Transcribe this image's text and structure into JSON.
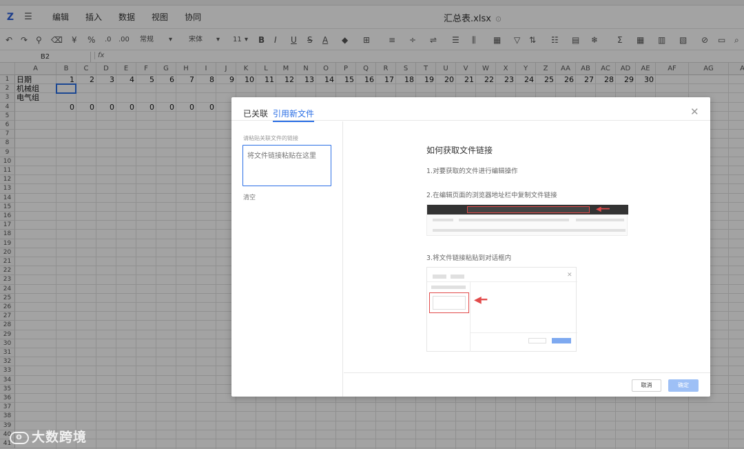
{
  "menu": {
    "logo": "Z",
    "items": [
      "编辑",
      "插入",
      "数据",
      "视图",
      "协同"
    ],
    "doc_title": "汇总表.xlsx"
  },
  "toolbar": {
    "number_format": "常规",
    "font_name": "宋体",
    "font_size": "11"
  },
  "formula": {
    "cell_ref": "B2",
    "fx": "fx"
  },
  "grid": {
    "columns": [
      "A",
      "B",
      "C",
      "D",
      "E",
      "F",
      "G",
      "H",
      "I",
      "J",
      "K",
      "L",
      "M",
      "N",
      "O",
      "P",
      "Q",
      "R",
      "S",
      "T",
      "U",
      "V",
      "W",
      "X",
      "Y",
      "Z",
      "AA",
      "AB",
      "AC",
      "AD",
      "AE",
      "AF",
      "AG",
      "A"
    ],
    "rows": [
      "1",
      "2",
      "3",
      "4",
      "5",
      "6",
      "7",
      "8",
      "9",
      "10",
      "11",
      "12",
      "13",
      "14",
      "15",
      "16",
      "17",
      "18",
      "19",
      "20",
      "21",
      "22",
      "23",
      "24",
      "25",
      "26",
      "27",
      "28",
      "29",
      "30",
      "31",
      "32",
      "33",
      "34",
      "35",
      "36",
      "37",
      "38",
      "39",
      "40",
      "41"
    ],
    "row1_label": "日期",
    "row1_values": [
      "1",
      "2",
      "3",
      "4",
      "5",
      "6",
      "7",
      "8",
      "9",
      "10",
      "11",
      "12",
      "13",
      "14",
      "15",
      "16",
      "17",
      "18",
      "19",
      "20",
      "21",
      "22",
      "23",
      "24",
      "25",
      "26",
      "27",
      "28",
      "29",
      "30"
    ],
    "row2_label": "机械组",
    "row3_label": "电气组",
    "row4_values": [
      "0",
      "0",
      "0",
      "0",
      "0",
      "0",
      "0",
      "0"
    ]
  },
  "dialog": {
    "tab_linked": "已关联",
    "tab_new": "引用新文件",
    "paste_label": "请粘贴关联文件的链接",
    "paste_placeholder": "将文件链接粘贴在这里",
    "clear": "清空",
    "guide_title": "如何获取文件链接",
    "step1": "1.对要获取的文件进行编辑操作",
    "step2": "2.在编辑页面的浏览器地址栏中复制文件链接",
    "step3": "3.将文件链接粘贴到对话框内",
    "cancel": "取消",
    "ok": "确定"
  },
  "watermark": {
    "text": "大数跨境"
  }
}
